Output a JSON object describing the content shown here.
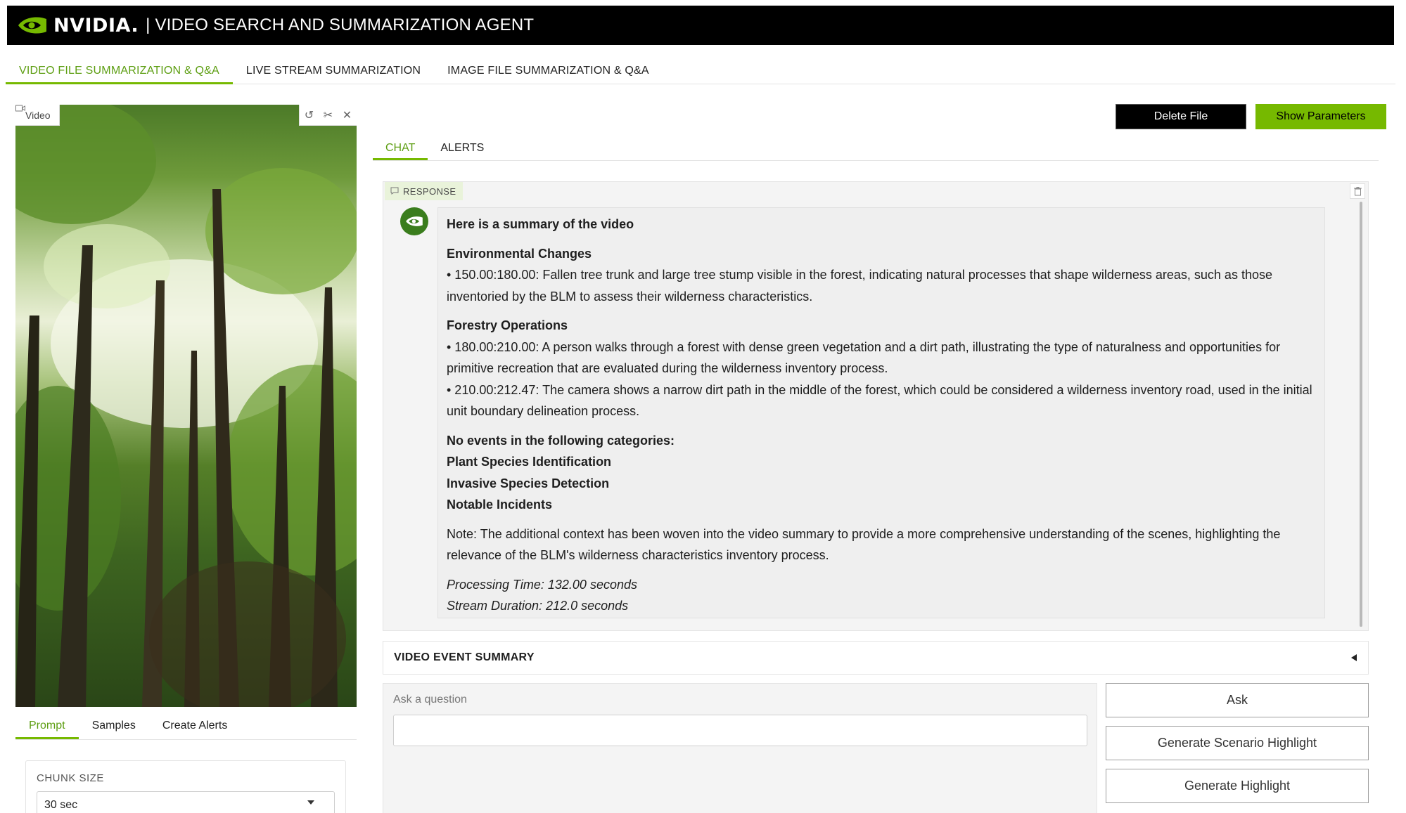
{
  "header": {
    "brand": "NVIDIA.",
    "title": "| VIDEO SEARCH AND SUMMARIZATION AGENT"
  },
  "top_tabs": [
    {
      "label": "VIDEO FILE SUMMARIZATION & Q&A",
      "active": true
    },
    {
      "label": "LIVE STREAM SUMMARIZATION",
      "active": false
    },
    {
      "label": "IMAGE FILE SUMMARIZATION & Q&A",
      "active": false
    }
  ],
  "video": {
    "label": "Video"
  },
  "left_tabs": [
    {
      "label": "Prompt",
      "active": true
    },
    {
      "label": "Samples",
      "active": false
    },
    {
      "label": "Create Alerts",
      "active": false
    }
  ],
  "chunk": {
    "label": "CHUNK SIZE",
    "value": "30 sec"
  },
  "buttons": {
    "delete_file": "Delete File",
    "show_parameters": "Show Parameters",
    "ask": "Ask",
    "generate_scenario_highlight": "Generate Scenario Highlight",
    "generate_highlight": "Generate Highlight"
  },
  "chat_tabs": [
    {
      "label": "CHAT",
      "active": true
    },
    {
      "label": "ALERTS",
      "active": false
    }
  ],
  "response": {
    "label": "RESPONSE",
    "summary_heading": "Here is a summary of the video",
    "env_heading": "Environmental Changes",
    "env_item_1": "• 150.00:180.00: Fallen tree trunk and large tree stump visible in the forest, indicating natural processes that shape wilderness areas, such as those inventoried by the BLM to assess their wilderness characteristics.",
    "forestry_heading": "Forestry Operations",
    "forestry_item_1": "• 180.00:210.00: A person walks through a forest with dense green vegetation and a dirt path, illustrating the type of naturalness and opportunities for primitive recreation that are evaluated during the wilderness inventory process.",
    "forestry_item_2": "• 210.00:212.47: The camera shows a narrow dirt path in the middle of the forest, which could be considered a wilderness inventory road, used in the initial unit boundary delineation process.",
    "no_events_heading": "No events in the following categories:",
    "no_events_1": "Plant Species Identification",
    "no_events_2": "Invasive Species Detection",
    "no_events_3": "Notable Incidents",
    "note": "Note: The additional context has been woven into the video summary to provide a more comprehensive understanding of the scenes, highlighting the relevance of the BLM's wilderness characteristics inventory process.",
    "processing_time": "Processing Time: 132.00 seconds",
    "stream_duration": "Stream Duration: 212.0 seconds"
  },
  "video_event_summary": {
    "label": "VIDEO EVENT SUMMARY"
  },
  "question": {
    "label": "Ask a question",
    "value": ""
  },
  "colors": {
    "accent": "#76b900",
    "header_bg": "#000000",
    "active_tab_text": "#5d9e12"
  },
  "icons": {
    "brand": "nvidia-eye-icon",
    "video": "video-camera-icon",
    "undo": "undo-icon",
    "trim": "scissors-icon",
    "close": "close-icon",
    "response": "chat-bubble-icon",
    "clear": "trash-icon",
    "collapse": "triangle-left-icon",
    "dropdown": "chevron-down-icon"
  }
}
